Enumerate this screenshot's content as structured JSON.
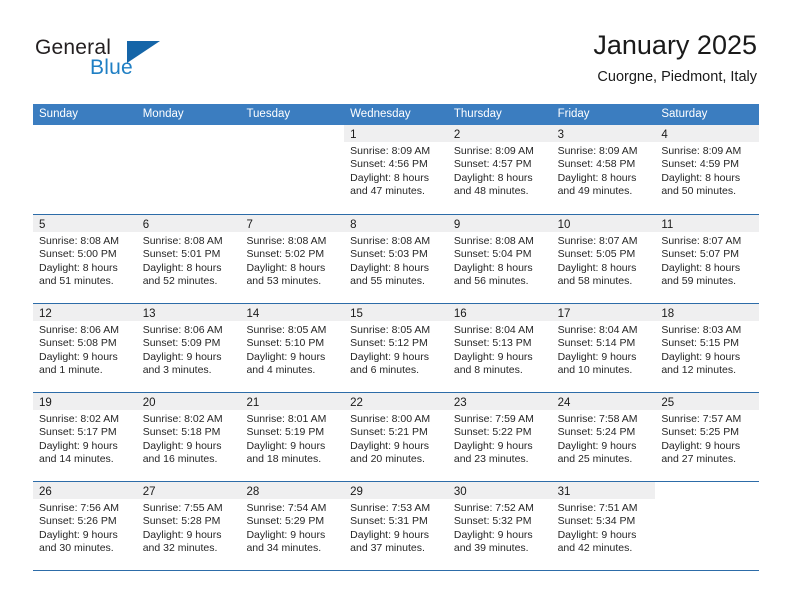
{
  "brand": {
    "name_part1": "General",
    "name_part2": "Blue",
    "triangle_color": "#1565a8",
    "blue_color": "#1f7fc4"
  },
  "header": {
    "title": "January 2025",
    "subtitle": "Cuorgne, Piedmont, Italy"
  },
  "theme": {
    "header_row_bg": "#3b7dc0",
    "week_rule_color": "#2d6ca8",
    "daynum_band_bg": "#efeff0",
    "text_color": "#1a1a1a"
  },
  "weekdays": [
    "Sunday",
    "Monday",
    "Tuesday",
    "Wednesday",
    "Thursday",
    "Friday",
    "Saturday"
  ],
  "weeks": [
    [
      {
        "day": "",
        "blank": true,
        "lines": []
      },
      {
        "day": "",
        "blank": true,
        "lines": []
      },
      {
        "day": "",
        "blank": true,
        "lines": []
      },
      {
        "day": "1",
        "lines": [
          "Sunrise: 8:09 AM",
          "Sunset: 4:56 PM",
          "Daylight: 8 hours",
          "and 47 minutes."
        ]
      },
      {
        "day": "2",
        "lines": [
          "Sunrise: 8:09 AM",
          "Sunset: 4:57 PM",
          "Daylight: 8 hours",
          "and 48 minutes."
        ]
      },
      {
        "day": "3",
        "lines": [
          "Sunrise: 8:09 AM",
          "Sunset: 4:58 PM",
          "Daylight: 8 hours",
          "and 49 minutes."
        ]
      },
      {
        "day": "4",
        "lines": [
          "Sunrise: 8:09 AM",
          "Sunset: 4:59 PM",
          "Daylight: 8 hours",
          "and 50 minutes."
        ]
      }
    ],
    [
      {
        "day": "5",
        "lines": [
          "Sunrise: 8:08 AM",
          "Sunset: 5:00 PM",
          "Daylight: 8 hours",
          "and 51 minutes."
        ]
      },
      {
        "day": "6",
        "lines": [
          "Sunrise: 8:08 AM",
          "Sunset: 5:01 PM",
          "Daylight: 8 hours",
          "and 52 minutes."
        ]
      },
      {
        "day": "7",
        "lines": [
          "Sunrise: 8:08 AM",
          "Sunset: 5:02 PM",
          "Daylight: 8 hours",
          "and 53 minutes."
        ]
      },
      {
        "day": "8",
        "lines": [
          "Sunrise: 8:08 AM",
          "Sunset: 5:03 PM",
          "Daylight: 8 hours",
          "and 55 minutes."
        ]
      },
      {
        "day": "9",
        "lines": [
          "Sunrise: 8:08 AM",
          "Sunset: 5:04 PM",
          "Daylight: 8 hours",
          "and 56 minutes."
        ]
      },
      {
        "day": "10",
        "lines": [
          "Sunrise: 8:07 AM",
          "Sunset: 5:05 PM",
          "Daylight: 8 hours",
          "and 58 minutes."
        ]
      },
      {
        "day": "11",
        "lines": [
          "Sunrise: 8:07 AM",
          "Sunset: 5:07 PM",
          "Daylight: 8 hours",
          "and 59 minutes."
        ]
      }
    ],
    [
      {
        "day": "12",
        "lines": [
          "Sunrise: 8:06 AM",
          "Sunset: 5:08 PM",
          "Daylight: 9 hours",
          "and 1 minute."
        ]
      },
      {
        "day": "13",
        "lines": [
          "Sunrise: 8:06 AM",
          "Sunset: 5:09 PM",
          "Daylight: 9 hours",
          "and 3 minutes."
        ]
      },
      {
        "day": "14",
        "lines": [
          "Sunrise: 8:05 AM",
          "Sunset: 5:10 PM",
          "Daylight: 9 hours",
          "and 4 minutes."
        ]
      },
      {
        "day": "15",
        "lines": [
          "Sunrise: 8:05 AM",
          "Sunset: 5:12 PM",
          "Daylight: 9 hours",
          "and 6 minutes."
        ]
      },
      {
        "day": "16",
        "lines": [
          "Sunrise: 8:04 AM",
          "Sunset: 5:13 PM",
          "Daylight: 9 hours",
          "and 8 minutes."
        ]
      },
      {
        "day": "17",
        "lines": [
          "Sunrise: 8:04 AM",
          "Sunset: 5:14 PM",
          "Daylight: 9 hours",
          "and 10 minutes."
        ]
      },
      {
        "day": "18",
        "lines": [
          "Sunrise: 8:03 AM",
          "Sunset: 5:15 PM",
          "Daylight: 9 hours",
          "and 12 minutes."
        ]
      }
    ],
    [
      {
        "day": "19",
        "lines": [
          "Sunrise: 8:02 AM",
          "Sunset: 5:17 PM",
          "Daylight: 9 hours",
          "and 14 minutes."
        ]
      },
      {
        "day": "20",
        "lines": [
          "Sunrise: 8:02 AM",
          "Sunset: 5:18 PM",
          "Daylight: 9 hours",
          "and 16 minutes."
        ]
      },
      {
        "day": "21",
        "lines": [
          "Sunrise: 8:01 AM",
          "Sunset: 5:19 PM",
          "Daylight: 9 hours",
          "and 18 minutes."
        ]
      },
      {
        "day": "22",
        "lines": [
          "Sunrise: 8:00 AM",
          "Sunset: 5:21 PM",
          "Daylight: 9 hours",
          "and 20 minutes."
        ]
      },
      {
        "day": "23",
        "lines": [
          "Sunrise: 7:59 AM",
          "Sunset: 5:22 PM",
          "Daylight: 9 hours",
          "and 23 minutes."
        ]
      },
      {
        "day": "24",
        "lines": [
          "Sunrise: 7:58 AM",
          "Sunset: 5:24 PM",
          "Daylight: 9 hours",
          "and 25 minutes."
        ]
      },
      {
        "day": "25",
        "lines": [
          "Sunrise: 7:57 AM",
          "Sunset: 5:25 PM",
          "Daylight: 9 hours",
          "and 27 minutes."
        ]
      }
    ],
    [
      {
        "day": "26",
        "lines": [
          "Sunrise: 7:56 AM",
          "Sunset: 5:26 PM",
          "Daylight: 9 hours",
          "and 30 minutes."
        ]
      },
      {
        "day": "27",
        "lines": [
          "Sunrise: 7:55 AM",
          "Sunset: 5:28 PM",
          "Daylight: 9 hours",
          "and 32 minutes."
        ]
      },
      {
        "day": "28",
        "lines": [
          "Sunrise: 7:54 AM",
          "Sunset: 5:29 PM",
          "Daylight: 9 hours",
          "and 34 minutes."
        ]
      },
      {
        "day": "29",
        "lines": [
          "Sunrise: 7:53 AM",
          "Sunset: 5:31 PM",
          "Daylight: 9 hours",
          "and 37 minutes."
        ]
      },
      {
        "day": "30",
        "lines": [
          "Sunrise: 7:52 AM",
          "Sunset: 5:32 PM",
          "Daylight: 9 hours",
          "and 39 minutes."
        ]
      },
      {
        "day": "31",
        "lines": [
          "Sunrise: 7:51 AM",
          "Sunset: 5:34 PM",
          "Daylight: 9 hours",
          "and 42 minutes."
        ]
      },
      {
        "day": "",
        "blank": true,
        "lines": []
      }
    ]
  ]
}
